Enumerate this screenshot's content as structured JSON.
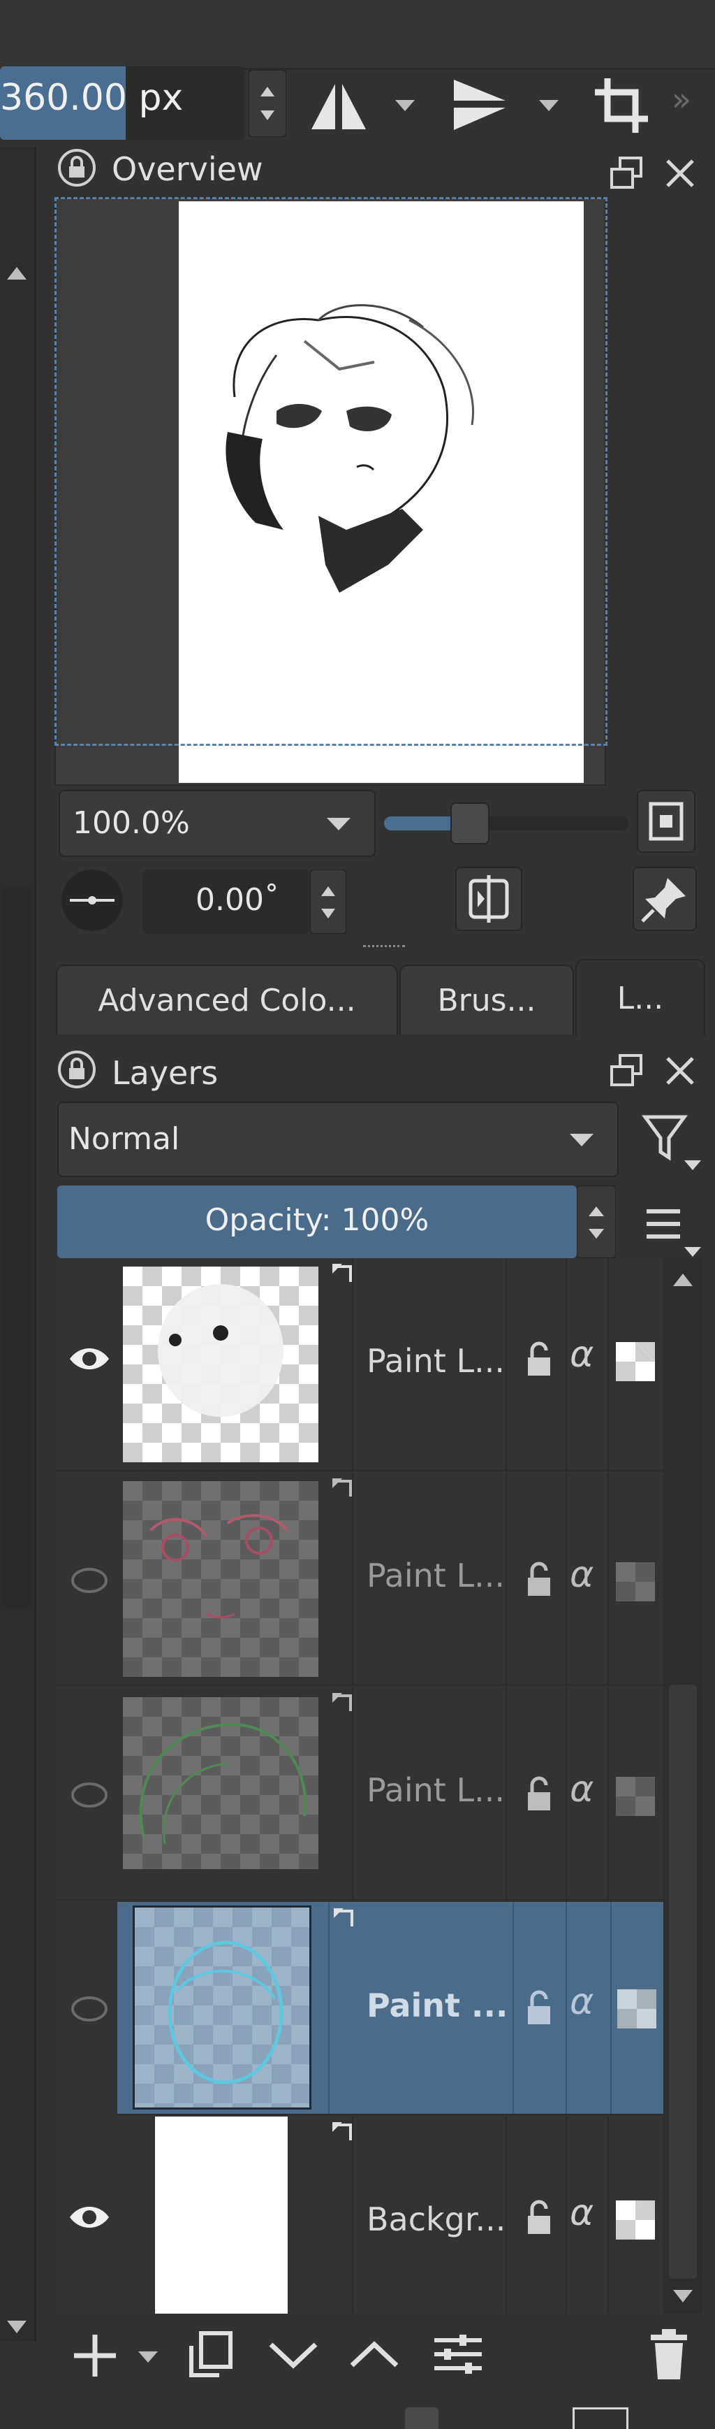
{
  "toolbar": {
    "size_value": "360.00 px",
    "more": "»"
  },
  "overview": {
    "title": "Overview"
  },
  "zoom": {
    "value": "100.0%",
    "slider_position": 0.35
  },
  "rotation": {
    "value": "0.00˚"
  },
  "dock_tabs": [
    {
      "label": "Advanced Colo..."
    },
    {
      "label": "Brus..."
    },
    {
      "label": "L..."
    }
  ],
  "layers_panel": {
    "title": "Layers",
    "blend_mode": "Normal",
    "opacity_label": "Opacity:  100%"
  },
  "layers": [
    {
      "name": "Paint L...",
      "visible": true,
      "selected": false
    },
    {
      "name": "Paint L...",
      "visible": false,
      "selected": false
    },
    {
      "name": "Paint L...",
      "visible": false,
      "selected": false
    },
    {
      "name": "Paint ...",
      "visible": false,
      "selected": true
    },
    {
      "name": "Backgr...",
      "visible": true,
      "selected": false
    }
  ],
  "layer_props": {
    "alpha_symbol": "α"
  },
  "colors": {
    "accent": "#4a6b8a",
    "input_highlight": "#4a6e92",
    "panel": "#323232"
  },
  "icons": {
    "mirror_horizontal": "mirror-horizontal-icon",
    "mirror_vertical": "mirror-vertical-icon",
    "crop": "crop-icon",
    "lock": "lock-icon",
    "float": "float-icon",
    "close": "close-icon",
    "filter": "filter-icon",
    "menu": "hamburger-menu-icon",
    "eye": "eye-icon",
    "add": "plus-icon",
    "duplicate": "duplicate-icon",
    "move_down": "chevron-down-icon",
    "move_up": "chevron-up-icon",
    "properties": "sliders-icon",
    "delete": "trash-icon"
  }
}
